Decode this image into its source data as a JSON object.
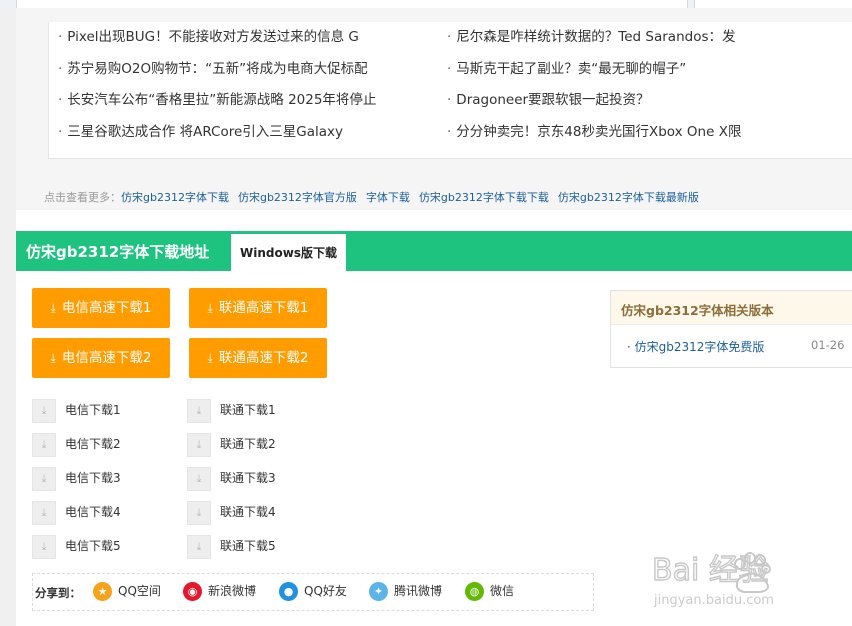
{
  "news": {
    "left": [
      "Pixel出现BUG！不能接收对方发送过来的信息 G",
      "苏宁易购O2O购物节：“五新”将成为电商大促标配",
      "长安汽车公布“香格里拉”新能源战略 2025年将停止",
      "三星谷歌达成合作 将ARCore引入三星Galaxy"
    ],
    "right": [
      "尼尔森是咋样统计数据的？Ted Sarandos：发",
      "马斯克干起了副业？卖“最无聊的帽子”",
      "Dragoneer要跟软银一起投资？",
      "分分钟卖完！京东48秒卖光国行Xbox One X限"
    ]
  },
  "more": {
    "label": "点击查看更多：",
    "links": [
      "仿宋gb2312字体下载",
      "仿宋gb2312字体官方版",
      "字体下载",
      "仿宋gb2312字体下载下载",
      "仿宋gb2312字体下载最新版"
    ]
  },
  "download": {
    "title": "仿宋gb2312字体下载地址",
    "tab": "Windows版下载",
    "buttons": [
      "电信高速下载1",
      "联通高速下载1",
      "电信高速下载2",
      "联通高速下载2"
    ],
    "small_left": [
      "电信下载1",
      "电信下载2",
      "电信下载3",
      "电信下载4",
      "电信下载5"
    ],
    "small_right": [
      "联通下载1",
      "联通下载2",
      "联通下载3",
      "联通下载4",
      "联通下载5"
    ]
  },
  "share": {
    "label": "分享到：",
    "items": [
      {
        "label": "QQ空间",
        "icon": "qzone-icon",
        "color": "#f6a21a"
      },
      {
        "label": "新浪微博",
        "icon": "weibo-icon",
        "color": "#e6162d"
      },
      {
        "label": "QQ好友",
        "icon": "qq-icon",
        "color": "#1e90e6"
      },
      {
        "label": "腾讯微博",
        "icon": "tencent-weibo-icon",
        "color": "#5bb4e8"
      },
      {
        "label": "微信",
        "icon": "wechat-icon",
        "color": "#62b900"
      }
    ]
  },
  "related": {
    "title": "仿宋gb2312字体相关版本",
    "items": [
      {
        "name": "仿宋gb2312字体免费版",
        "date": "01-26"
      }
    ]
  },
  "watermark": {
    "brand": "Bai 经验",
    "url": "jingyan.baidu.com"
  },
  "colors": {
    "accent_green": "#1ec380",
    "button_orange": "#ff9c00",
    "link_blue": "#1a5f9e"
  }
}
